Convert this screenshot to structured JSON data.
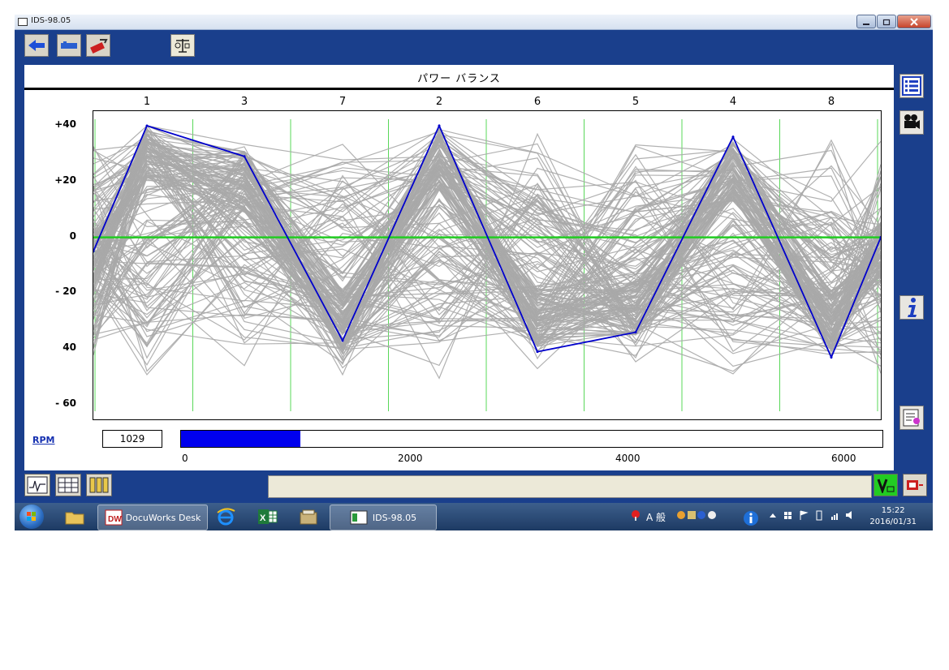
{
  "window": {
    "title": "IDS-98.05"
  },
  "panel": {
    "title": "パワー バランス"
  },
  "chart_data": {
    "type": "line",
    "title": "パワー バランス",
    "categories": [
      "1",
      "3",
      "7",
      "2",
      "6",
      "5",
      "4",
      "8"
    ],
    "y_ticks": [
      "+40",
      "+20",
      "0",
      "- 20",
      "40",
      "- 60"
    ],
    "ylim": [
      -65,
      45
    ],
    "zero_line": 0,
    "highlight_series": {
      "values": [
        -5,
        40,
        29,
        -37,
        40,
        -41,
        -34,
        36,
        -43,
        0
      ],
      "color": "#0000cc"
    },
    "background_series_color": "#a8a8a8",
    "grid": true,
    "grid_color": "#22cc22"
  },
  "rpm": {
    "label": "RPM",
    "value": "1029",
    "fraction": 0.17,
    "ticks": [
      "0",
      "2000",
      "4000",
      "6000"
    ],
    "color": "#0000ee"
  },
  "taskbar": {
    "docuworks_label": "DocuWorks Desk",
    "active_task_label": "IDS-98.05",
    "tray_text": "A 般",
    "time": "15:22",
    "date": "2016/01/31"
  }
}
